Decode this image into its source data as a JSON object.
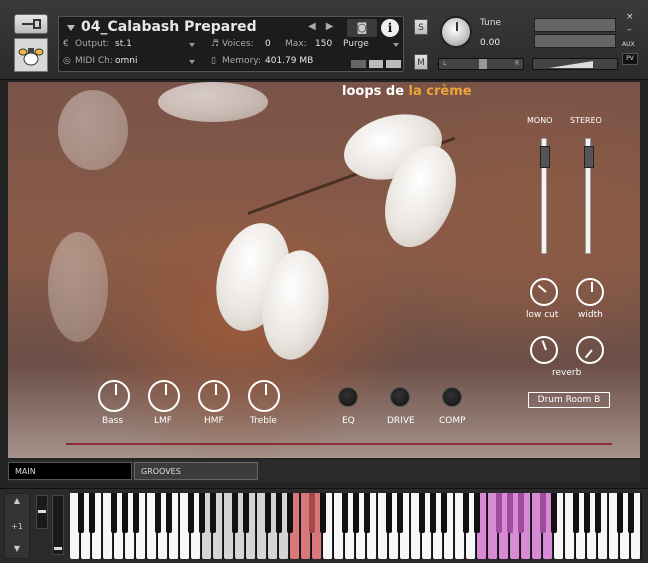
{
  "header": {
    "instrument_name": "04_Calabash Prepared",
    "output_label": "Output:",
    "output_value": "st.1",
    "voices_label": "Voices:",
    "voices_value": "0",
    "max_label": "Max:",
    "max_value": "150",
    "purge_label": "Purge",
    "midi_label": "MIDI Ch:",
    "midi_value": "omni",
    "memory_label": "Memory:",
    "memory_value": "401.79 MB",
    "solo_label": "S",
    "mute_label": "M",
    "tune_label": "Tune",
    "tune_value": "0.00",
    "pan_left": "L",
    "pan_right": "R",
    "aux_label": "AUX",
    "pv_label": "PV",
    "close_glyph": "×",
    "minimize_glyph": "–",
    "info_glyph": "i"
  },
  "brand": {
    "part1": "loops de ",
    "part2": "la crème"
  },
  "mixer": {
    "mono_label": "MONO",
    "stereo_label": "STEREO",
    "mono_level": 0.88,
    "stereo_level": 0.88
  },
  "knobs": {
    "bass": "Bass",
    "lmf": "LMF",
    "hmf": "HMF",
    "treble": "Treble",
    "low_cut": "low cut",
    "width": "width",
    "reverb": "reverb"
  },
  "toggles": {
    "eq": "EQ",
    "drive": "DRIVE",
    "comp": "COMP"
  },
  "reverb_type": "Drum Room B",
  "tabs": {
    "main": "MAIN",
    "grooves": "GROOVES"
  },
  "keyboard": {
    "octave_label": "+1",
    "highlight_red": "#d9787a",
    "highlight_pink": "#d98ad6",
    "highlight_grey": "#d4d4d4"
  },
  "colors": {
    "brand_accent": "#f0a43a",
    "divider": "#8c2d33"
  }
}
